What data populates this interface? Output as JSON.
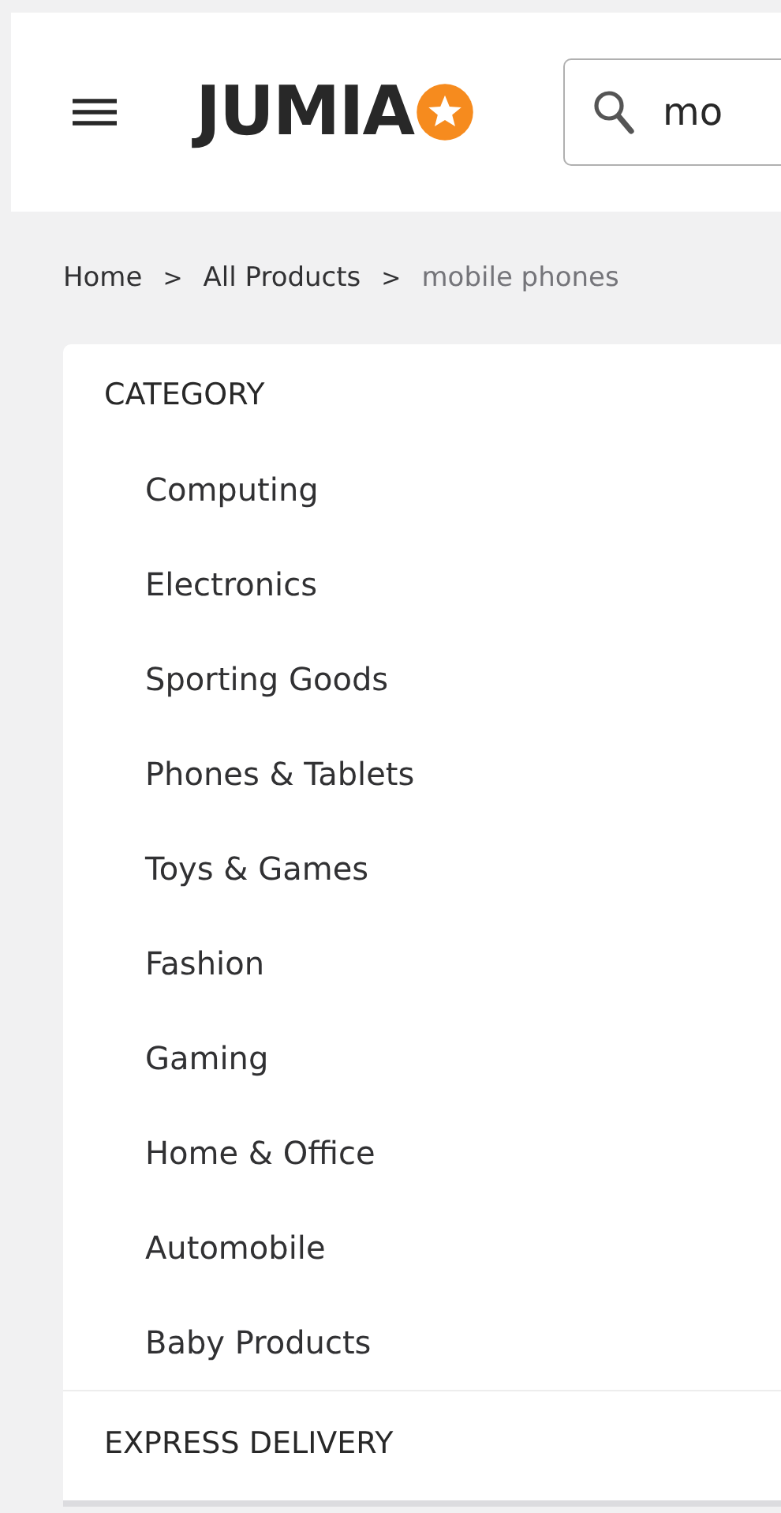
{
  "header": {
    "logo": "JUMIA",
    "search": {
      "value": "mo"
    }
  },
  "breadcrumb": [
    {
      "label": "Home",
      "current": false
    },
    {
      "label": "All Products",
      "current": false
    },
    {
      "label": "mobile phones",
      "current": true
    }
  ],
  "breadcrumb_separator": ">",
  "filters": [
    {
      "title": "CATEGORY",
      "items": [
        "Computing",
        "Electronics",
        "Sporting Goods",
        "Phones & Tablets",
        "Toys & Games",
        "Fashion",
        "Gaming",
        "Home & Office",
        "Automobile",
        "Baby Products"
      ]
    },
    {
      "title": "EXPRESS DELIVERY"
    }
  ]
}
